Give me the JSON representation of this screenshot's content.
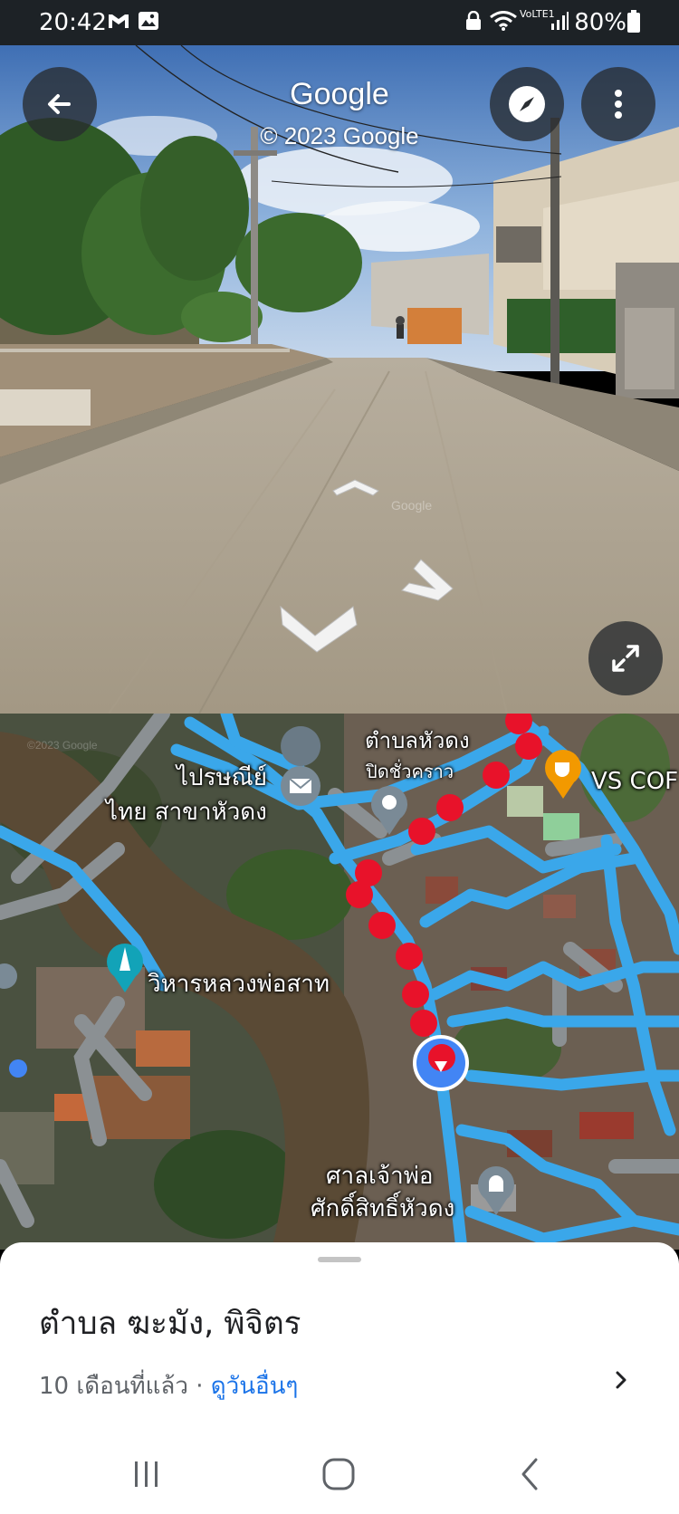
{
  "status_bar": {
    "time": "20:42",
    "notification_icons": [
      "gmail-icon",
      "gallery-icon"
    ],
    "right_icons": [
      "lock-icon",
      "wifi-icon",
      "volte-icon",
      "signal-icon"
    ],
    "network_label": "VoLTE1",
    "battery": "80%"
  },
  "street_view": {
    "title": "Google",
    "copyright": "© 2023 Google",
    "watermark": "Google",
    "buttons": [
      "back-icon",
      "compass-icon",
      "more-vert-icon",
      "expand-icon"
    ]
  },
  "map": {
    "labels": {
      "subdistrict": "ตำบลหัวดง",
      "post_office_line1": "ไปรษณีย์",
      "post_office_line2": "ไทย สาขาหัวดง",
      "temporarily_closed": "ปิดชั่วคราว",
      "cafe": "VS COF",
      "temple": "วิหารหลวงพ่อสาท",
      "shrine_line1": "ศาลเจ้าพ่อ",
      "shrine_line2": "ศักดิ์สิทธิ์หัวดง",
      "map_watermark": "©2023 Google"
    },
    "colors": {
      "road": "#3aa7ea",
      "gray_road": "#8b9093",
      "path_dot": "#e8122a",
      "river": "#5a4a35",
      "pegman": "#4285f4"
    }
  },
  "bottom_sheet": {
    "title": "ตำบล ฆะมัง, พิจิตร",
    "date_text": "10 เดือนที่แล้ว",
    "separator": " · ",
    "link_text": "ดูวันอื่นๆ"
  },
  "nav_bar": {
    "buttons": [
      "recent-apps-icon",
      "home-icon",
      "back-nav-icon"
    ]
  }
}
